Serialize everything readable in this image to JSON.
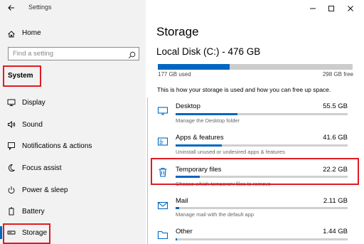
{
  "window": {
    "title": "Settings"
  },
  "sidebar": {
    "home_label": "Home",
    "search_placeholder": "Find a setting",
    "section_label": "System",
    "items": [
      {
        "label": "Display",
        "icon": "monitor-icon"
      },
      {
        "label": "Sound",
        "icon": "speaker-icon"
      },
      {
        "label": "Notifications & actions",
        "icon": "notification-icon"
      },
      {
        "label": "Focus assist",
        "icon": "moon-icon"
      },
      {
        "label": "Power & sleep",
        "icon": "power-icon"
      },
      {
        "label": "Battery",
        "icon": "battery-icon"
      },
      {
        "label": "Storage",
        "icon": "storage-icon"
      }
    ]
  },
  "main": {
    "page_title": "Storage",
    "disk_title": "Local Disk (C:) - 476 GB",
    "used_label": "177 GB used",
    "free_label": "298 GB free",
    "used_fraction": 0.37,
    "description": "This is how your storage is used and how you can free up space.",
    "categories": [
      {
        "name": "Desktop",
        "size": "55.5 GB",
        "desc": "Manage the Desktop folder",
        "fraction": 0.36,
        "icon": "desktop-icon"
      },
      {
        "name": "Apps & features",
        "size": "41.6 GB",
        "desc": "Uninstall unused or undesired apps & features",
        "fraction": 0.27,
        "icon": "apps-icon"
      },
      {
        "name": "Temporary files",
        "size": "22.2 GB",
        "desc": "Choose which temporary files to remove",
        "fraction": 0.14,
        "icon": "trash-icon"
      },
      {
        "name": "Mail",
        "size": "2.11 GB",
        "desc": "Manage mail with the default app",
        "fraction": 0.02,
        "icon": "mail-icon"
      },
      {
        "name": "Other",
        "size": "1.44 GB",
        "desc": "",
        "fraction": 0.01,
        "icon": "folder-icon"
      }
    ]
  },
  "colors": {
    "accent": "#0067c0",
    "highlight": "#e11b22"
  }
}
